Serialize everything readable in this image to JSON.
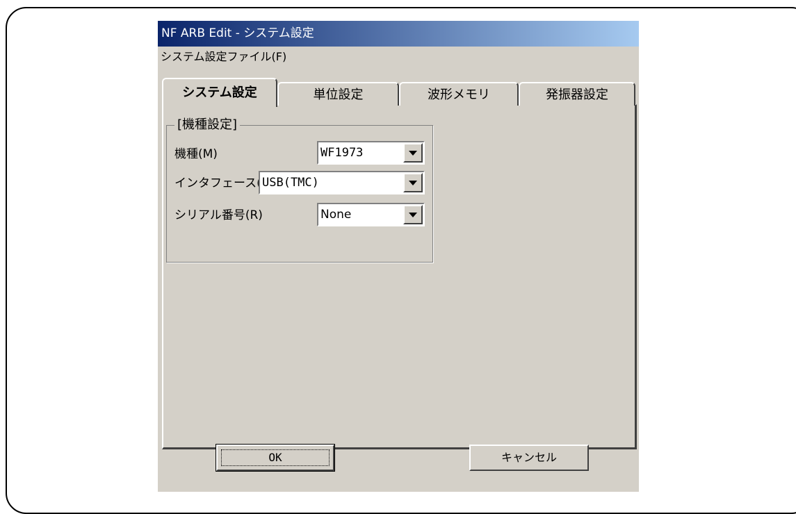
{
  "window": {
    "title": "NF ARB Edit - システム設定"
  },
  "menu": {
    "items": [
      "システム設定ファイル(F)"
    ]
  },
  "tabs": [
    {
      "label": "システム設定",
      "active": true
    },
    {
      "label": "単位設定",
      "active": false
    },
    {
      "label": "波形メモリ",
      "active": false
    },
    {
      "label": "発振器設定",
      "active": false
    }
  ],
  "group": {
    "title": "[機種設定]",
    "fields": [
      {
        "label": "機種(M)",
        "value": "WF1973"
      },
      {
        "label": "インタフェース(I)",
        "value": "USB(TMC)"
      },
      {
        "label": "シリアル番号(R)",
        "value": "None"
      }
    ]
  },
  "buttons": {
    "ok": "OK",
    "cancel": "キャンセル"
  },
  "colors": {
    "face": "#d4d0c8",
    "title_start": "#0a246a",
    "title_end": "#a6caf0"
  }
}
